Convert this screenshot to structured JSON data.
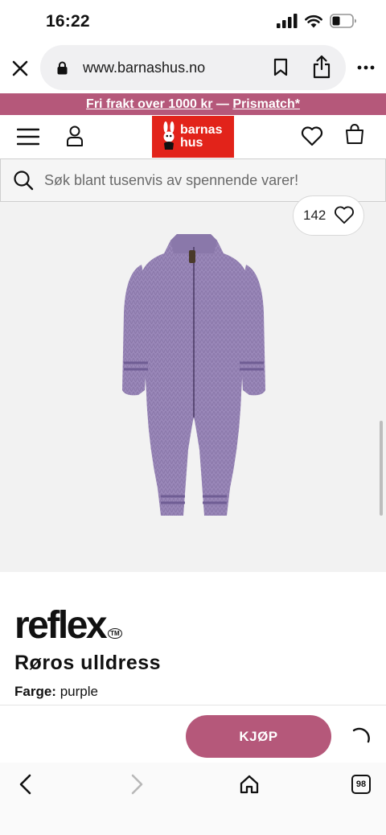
{
  "status": {
    "time": "16:22"
  },
  "browser": {
    "url": "www.barnashus.no"
  },
  "promo": {
    "part1": "Fri frakt over 1000 kr",
    "sep": " — ",
    "part2": "Prismatch*"
  },
  "header": {
    "logo_line1": "barnas",
    "logo_line2": "hus"
  },
  "search": {
    "placeholder": "Søk blant tusenvis av spennende varer!"
  },
  "product": {
    "likes": "142",
    "brand": "reflex",
    "brand_mark": "TM",
    "name": "Røros ulldress",
    "color_label": "Farge:",
    "color_value": "purple",
    "color_swatch": "#9b86b8"
  },
  "buy": {
    "label": "KJØP"
  },
  "nav": {
    "tabs_count": "98"
  },
  "colors": {
    "accent": "#b5587a",
    "logo": "#e2231a"
  }
}
